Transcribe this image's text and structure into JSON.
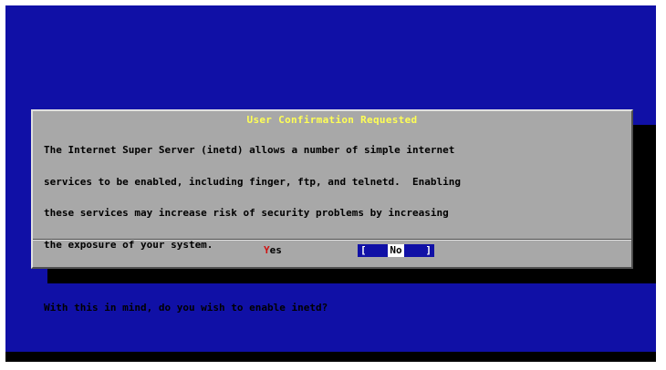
{
  "dialog": {
    "title": "User Confirmation Requested",
    "body_lines": [
      "The Internet Super Server (inetd) allows a number of simple internet",
      "services to be enabled, including finger, ftp, and telnetd.  Enabling",
      "these services may increase risk of security problems by increasing",
      "the exposure of your system."
    ],
    "question": "With this in mind, do you wish to enable inetd?",
    "buttons": {
      "yes_hotkey": "Y",
      "yes_rest": "es",
      "no_bracket_left": "[",
      "no_label": "No",
      "no_bracket_right": "]"
    }
  },
  "colors": {
    "background": "#1010a6",
    "dialog": "#a8a8a8",
    "title": "#ffff55",
    "hotkey": "#d01010",
    "shadow": "#000000"
  }
}
